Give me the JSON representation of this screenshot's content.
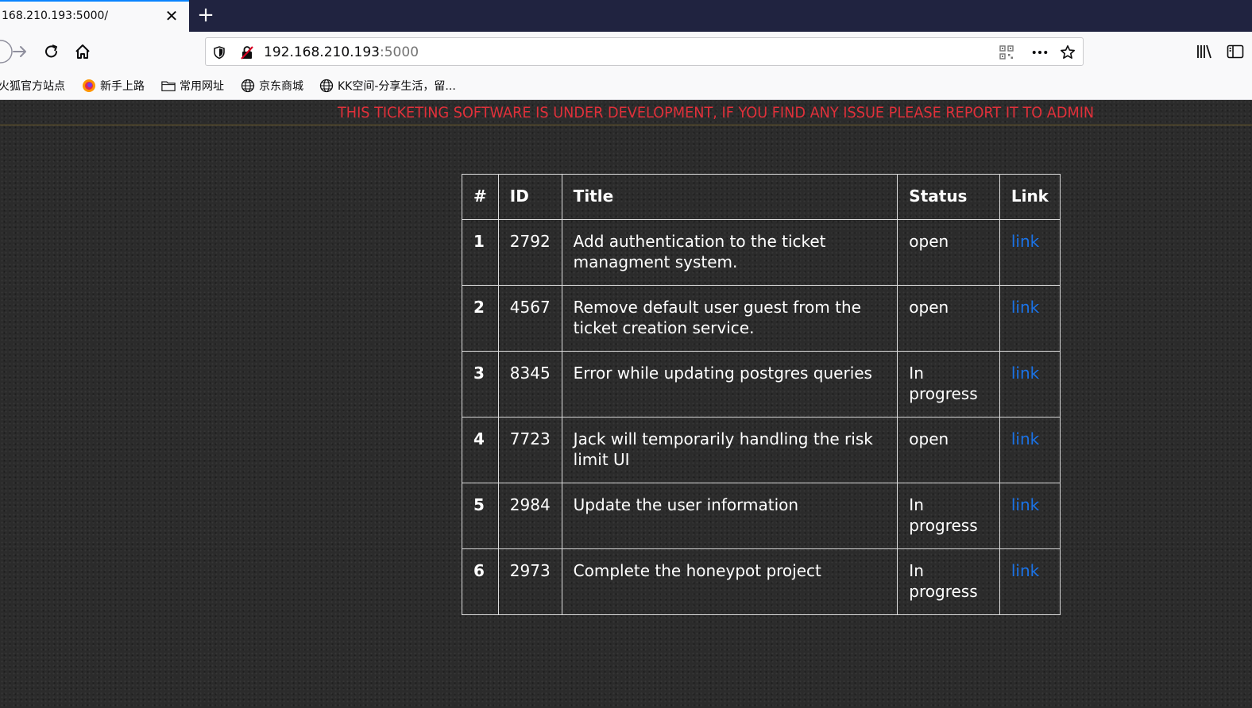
{
  "browser": {
    "tab_title": "168.210.193:5000/",
    "url_host": "192.168.210.193",
    "url_port": ":5000",
    "bookmarks": [
      {
        "label": "火狐官方站点",
        "icon": "firefox-icon"
      },
      {
        "label": "新手上路",
        "icon": "firefox-icon"
      },
      {
        "label": "常用网址",
        "icon": "folder-icon"
      },
      {
        "label": "京东商城",
        "icon": "globe-icon"
      },
      {
        "label": "KK空间-分享生活，留...",
        "icon": "globe-icon"
      }
    ]
  },
  "page": {
    "banner": "THIS TICKETING SOFTWARE IS UNDER DEVELOPMENT, IF YOU FIND ANY ISSUE PLEASE REPORT IT TO ADMIN",
    "columns": [
      "#",
      "ID",
      "Title",
      "Status",
      "Link"
    ],
    "rows": [
      {
        "num": "1",
        "id": "2792",
        "title": "Add authentication to the ticket managment system.",
        "status": "open",
        "link": "link"
      },
      {
        "num": "2",
        "id": "4567",
        "title": "Remove default user guest from the ticket creation service.",
        "status": "open",
        "link": "link"
      },
      {
        "num": "3",
        "id": "8345",
        "title": "Error while updating postgres queries",
        "status": "In progress",
        "link": "link"
      },
      {
        "num": "4",
        "id": "7723",
        "title": "Jack will temporarily handling the risk limit UI",
        "status": "open",
        "link": "link"
      },
      {
        "num": "5",
        "id": "2984",
        "title": "Update the user information",
        "status": "In progress",
        "link": "link"
      },
      {
        "num": "6",
        "id": "2973",
        "title": "Complete the honeypot project",
        "status": "In progress",
        "link": "link"
      }
    ]
  },
  "colors": {
    "banner_text": "#e0303a",
    "link": "#1a73e8",
    "tabstrip": "#202340"
  }
}
